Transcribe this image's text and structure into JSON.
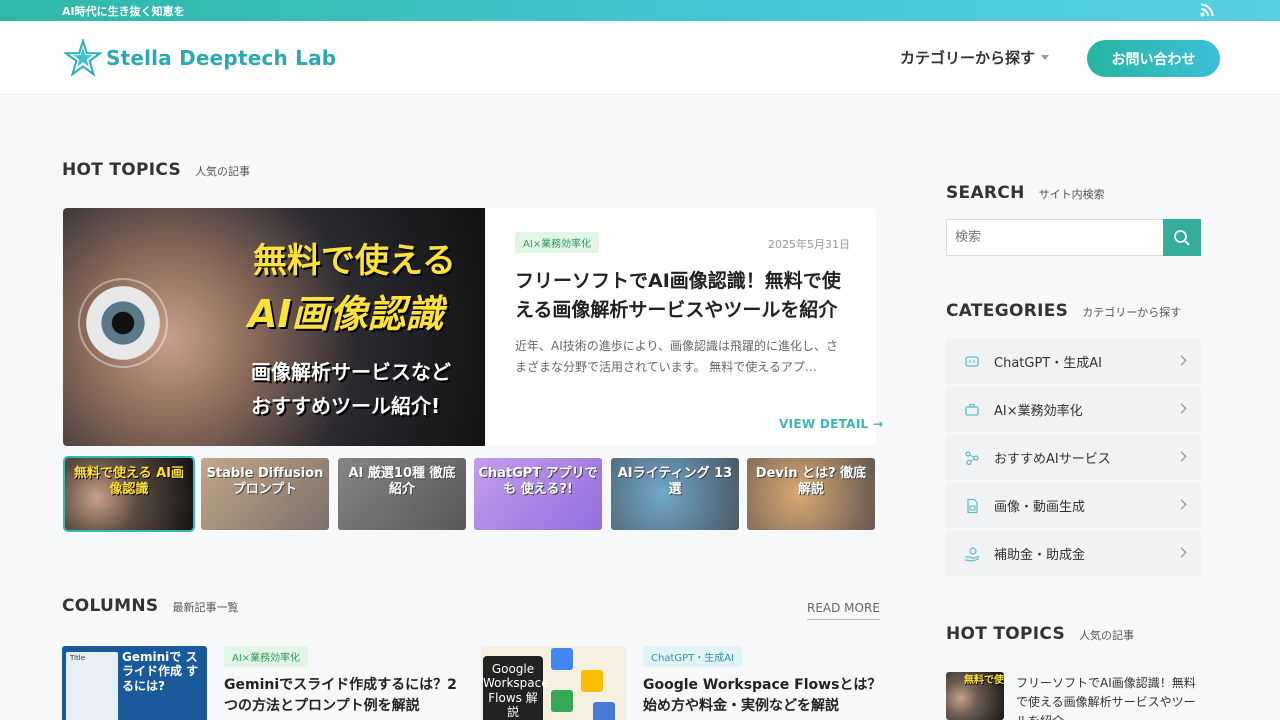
{
  "topbar": {
    "tagline": "AI時代に生き抜く知恵を",
    "icon": "rss-icon"
  },
  "header": {
    "logo_text": "Stella Deeptech Lab",
    "nav_category": "カテゴリーから探す",
    "contact_label": "お問い合わせ"
  },
  "hot_topics": {
    "title_en": "HOT TOPICS",
    "title_ja": "人気の記事",
    "featured": {
      "badge": "AI×業務効率化",
      "date": "2025年5月31日",
      "title": "フリーソフトでAI画像認識！無料で使える画像解析サービスやツールを紹介",
      "excerpt": "近年、AI技術の進歩により、画像認識は飛躍的に進化し、さまざまな分野で活用されています。 無料で使えるアプ…",
      "image_text": [
        "無料で使える",
        "AI画像認識",
        "画像解析サービスなど",
        "おすすめツール紹介!"
      ],
      "view_detail": "VIEW DETAIL →"
    },
    "thumbnails": [
      {
        "caption": "無料で使える AI画像認識",
        "color": "#2a2a30",
        "active": true
      },
      {
        "caption": "Stable Diffusion プロンプト",
        "color": "#8a6a50",
        "active": false
      },
      {
        "caption": "AI 厳選10種 徹底紹介",
        "color": "#3a3a3a",
        "active": false
      },
      {
        "caption": "ChatGPT アプリでも 使える?!",
        "color": "#8a4ad8",
        "active": false
      },
      {
        "caption": "AIライティング 13選",
        "color": "#1a3a55",
        "active": false
      },
      {
        "caption": "Devin とは? 徹底解説",
        "color": "#5a3a2a",
        "active": false
      }
    ]
  },
  "columns": {
    "title_en": "COLUMNS",
    "title_ja": "最新記事一覧",
    "read_more": "READ MORE",
    "items": [
      {
        "badge": "AI×業務効率化",
        "title": "Geminiでスライド作成するには？2つの方法とプロンプト例を解説",
        "image_text": "Geminiで スライド作成 するには?",
        "image_label": "Title"
      },
      {
        "badge": "ChatGPT・生成AI",
        "title": "Google Workspace Flowsとは？始め方や料金・実例などを解説",
        "image_text": "Google Workspace Flows 解説"
      }
    ]
  },
  "sidebar": {
    "search": {
      "title_en": "SEARCH",
      "title_ja": "サイト内検索",
      "placeholder": "検索"
    },
    "categories": {
      "title_en": "CATEGORIES",
      "title_ja": "カテゴリーから探す",
      "items": [
        {
          "label": "ChatGPT・生成AI",
          "icon": "chat-bot-icon"
        },
        {
          "label": "AI×業務効率化",
          "icon": "briefcase-icon"
        },
        {
          "label": "おすすめAIサービス",
          "icon": "network-icon"
        },
        {
          "label": "画像・動画生成",
          "icon": "image-file-icon"
        },
        {
          "label": "補助金・助成金",
          "icon": "coin-hand-icon"
        }
      ]
    },
    "hot_topics": {
      "title_en": "HOT TOPICS",
      "title_ja": "人気の記事",
      "first_title": "フリーソフトでAI画像認識！無料で使える画像解析サービスやツールを紹介",
      "image_text": "無料で使 AI画像"
    }
  },
  "colors": {
    "accent": "#34ad9c",
    "accent_light": "#3cc0d8"
  }
}
